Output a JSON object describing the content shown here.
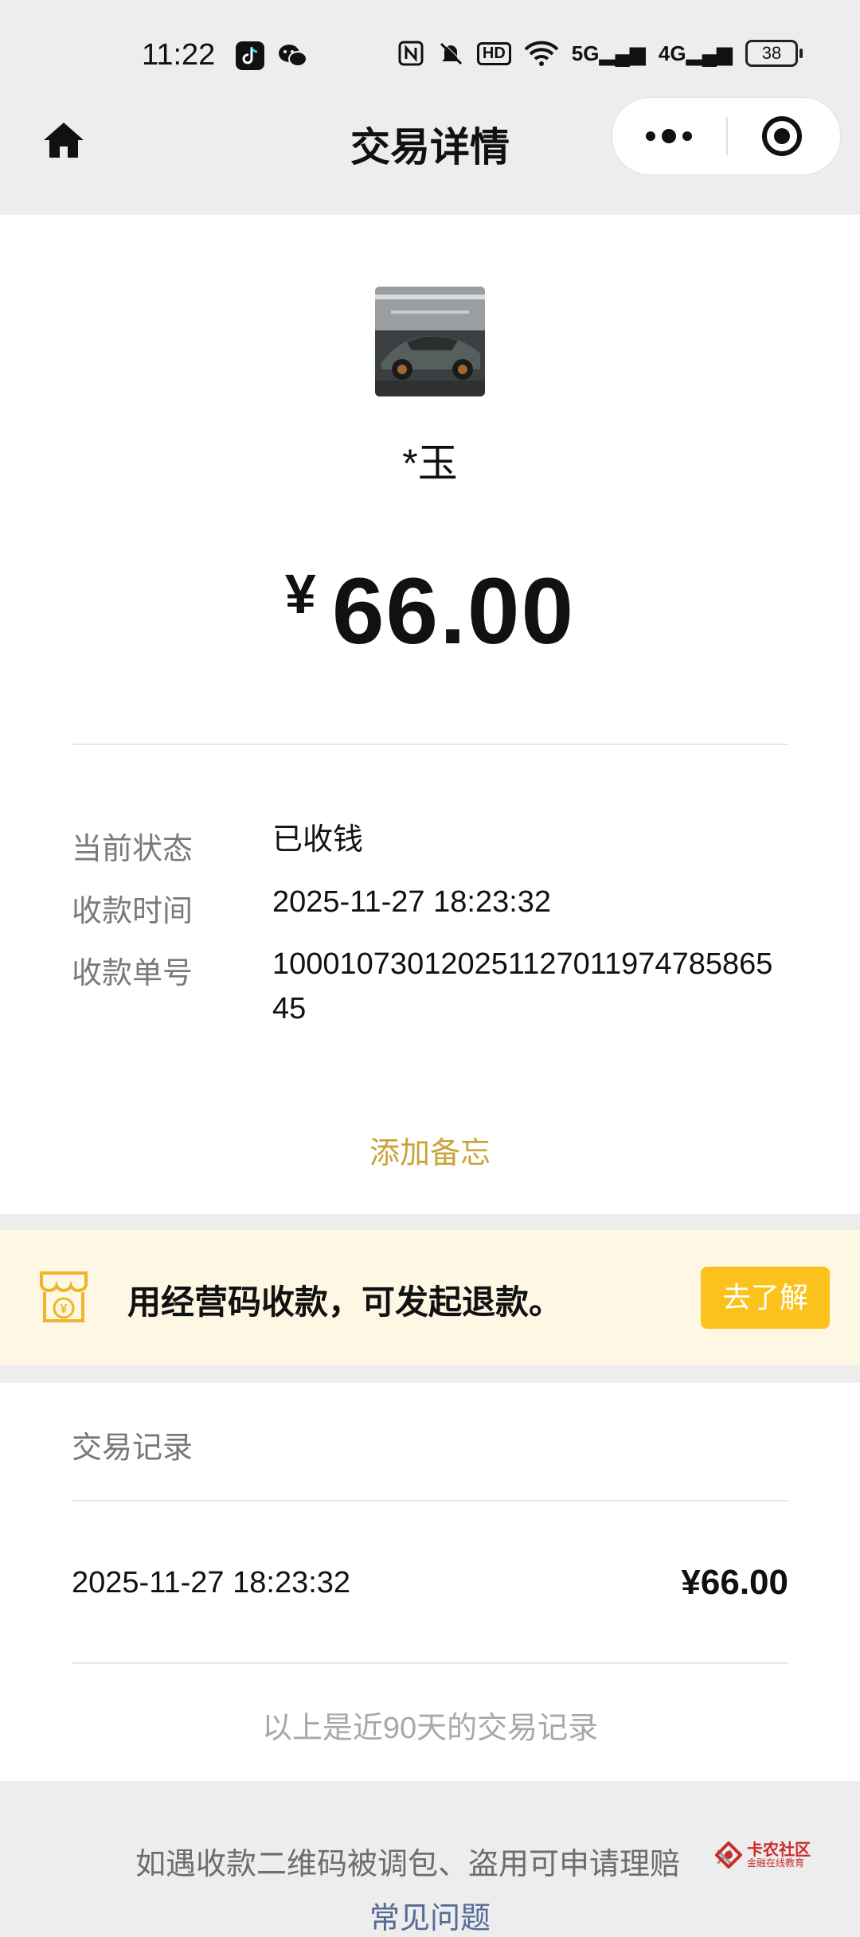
{
  "status_bar": {
    "time": "11:22",
    "hd_label": "HD",
    "net_5g": "5G",
    "net_4g": "4G",
    "battery": "38"
  },
  "nav": {
    "title": "交易详情"
  },
  "payment": {
    "payer_name": "*玉",
    "currency_symbol": "¥",
    "amount": "66.00"
  },
  "details": [
    {
      "label": "当前状态",
      "value": "已收钱"
    },
    {
      "label": "收款时间",
      "value": "2025-11-27 18:23:32"
    },
    {
      "label": "收款单号",
      "value": "100010730120251127011974785865 45"
    }
  ],
  "add_memo": "添加备忘",
  "banner": {
    "text": "用经营码收款，可发起退款。",
    "button": "去了解",
    "icon_symbol": "¥"
  },
  "records": {
    "title": "交易记录",
    "items": [
      {
        "date": "2025-11-27 18:23:32",
        "amount": "¥66.00"
      }
    ],
    "footer": "以上是近90天的交易记录"
  },
  "bottom": {
    "claim_text": "如遇收款二维码被调包、盗用可申请理赔",
    "close_glyph": "✕",
    "faq": "常见问题"
  },
  "watermark": {
    "name": "卡农社区",
    "sub": "金融在线教育"
  },
  "colors": {
    "accent_gold": "#c9a43b",
    "button_yellow": "#fbc21b",
    "banner_bg": "#fdf7e4",
    "link_blue": "#576b95"
  }
}
